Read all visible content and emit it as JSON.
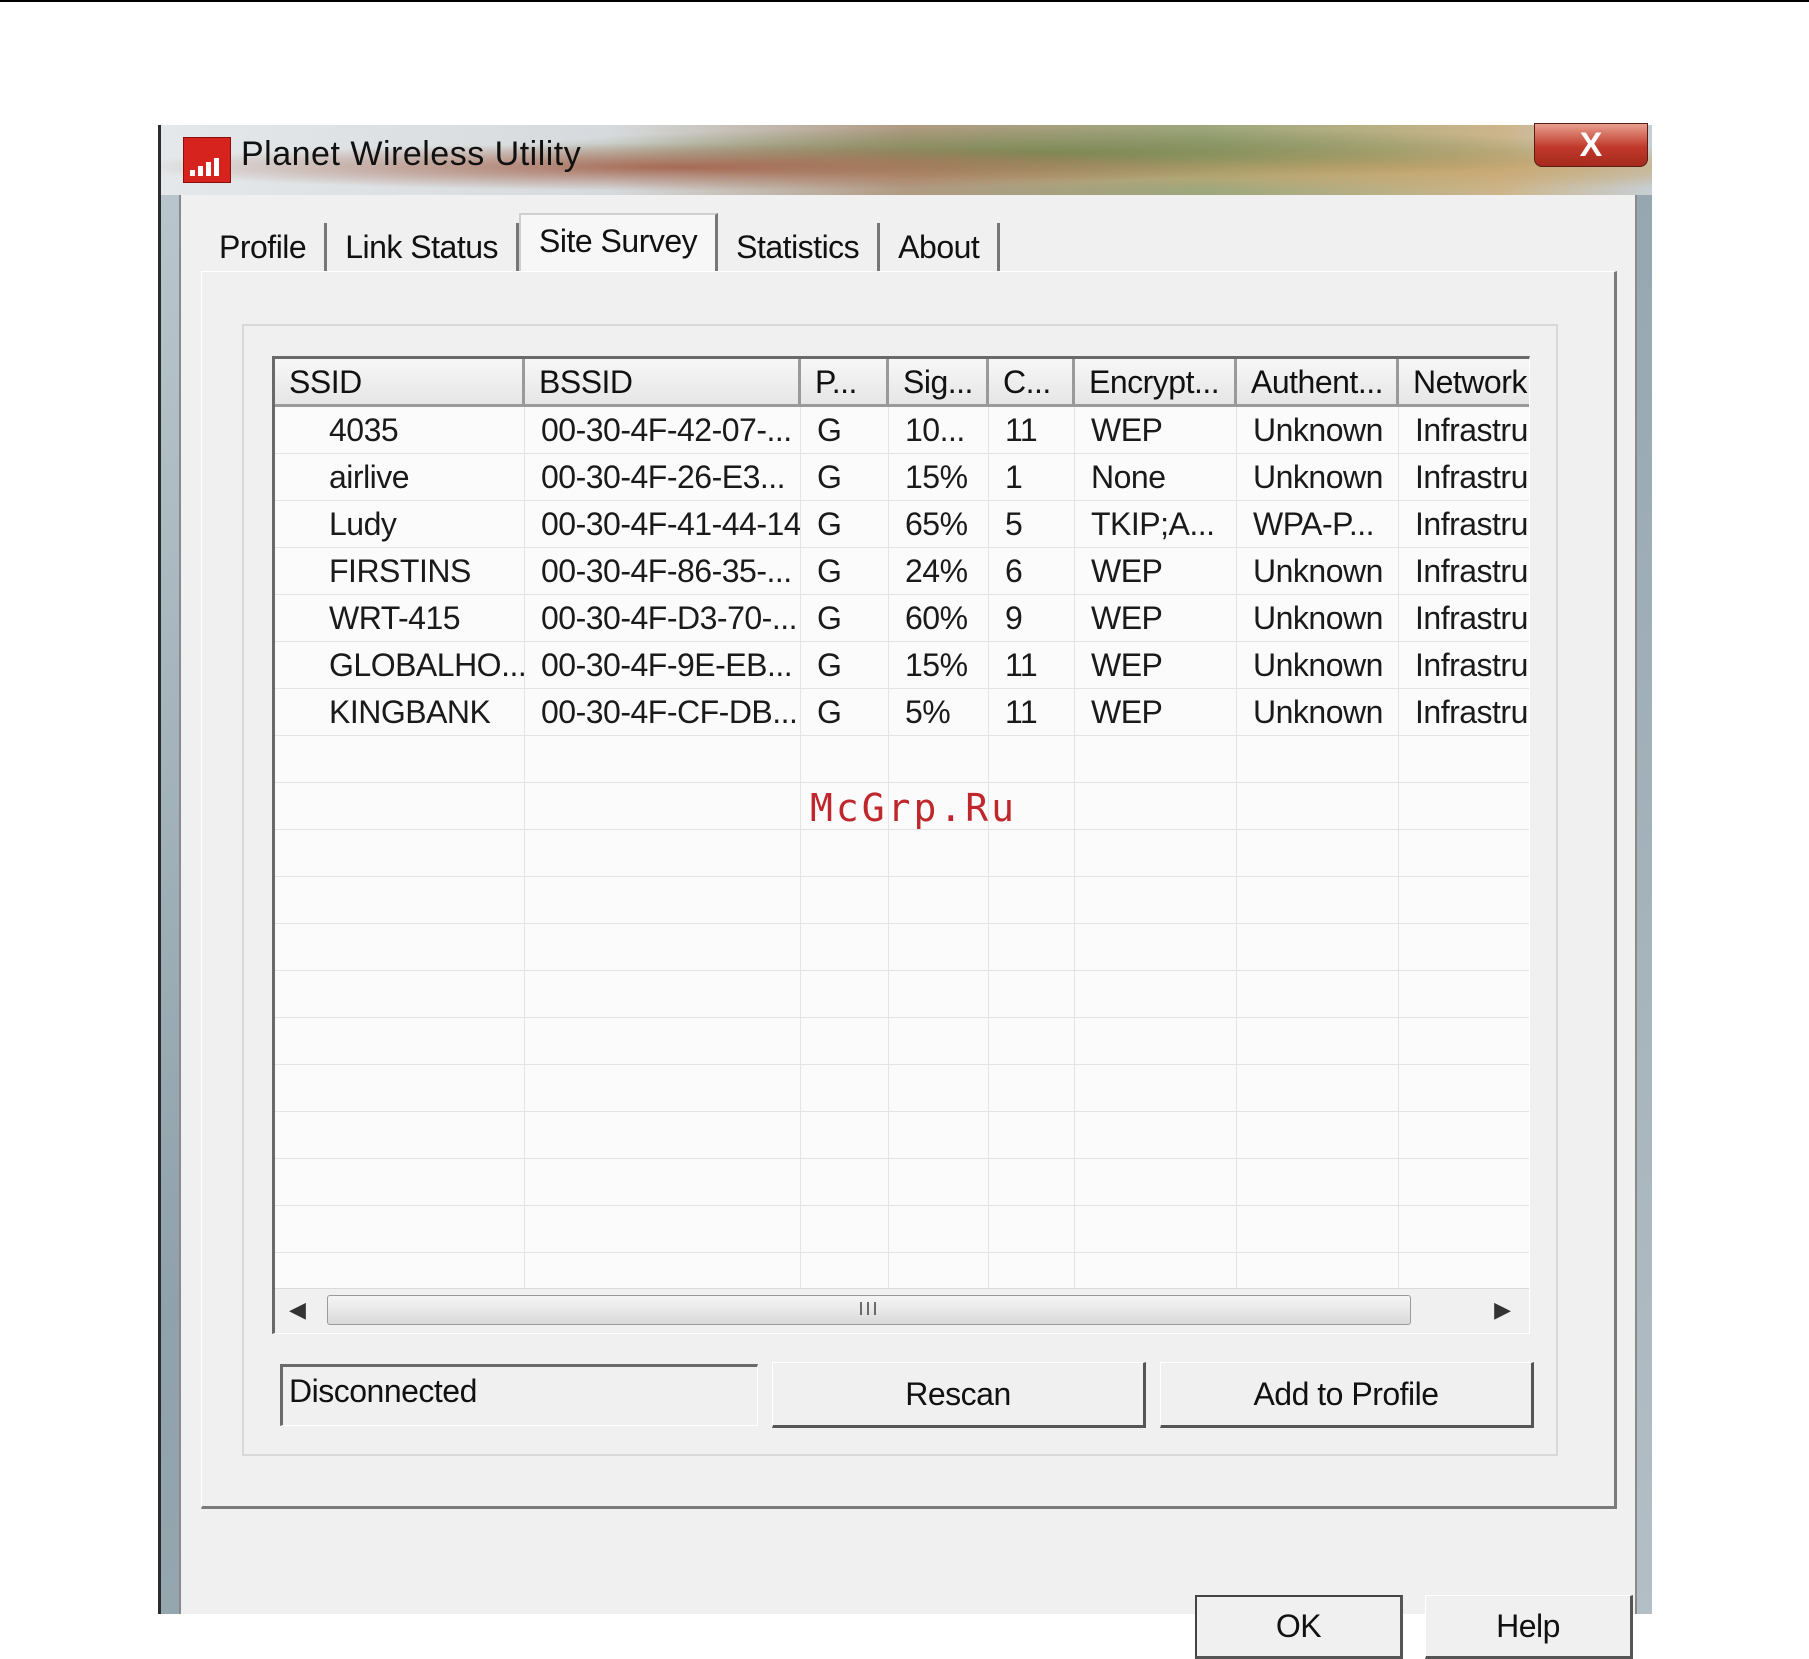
{
  "window": {
    "title": "Planet Wireless Utility",
    "close_glyph": "X"
  },
  "tabs": [
    {
      "label": "Profile",
      "active": false
    },
    {
      "label": "Link Status",
      "active": false
    },
    {
      "label": "Site Survey",
      "active": true
    },
    {
      "label": "Statistics",
      "active": false
    },
    {
      "label": "About",
      "active": false
    }
  ],
  "site_survey": {
    "columns": [
      "SSID",
      "BSSID",
      "P...",
      "Sig...",
      "C...",
      "Encrypt...",
      "Authent...",
      "Network"
    ],
    "rows": [
      [
        "4035",
        "00-30-4F-42-07-...",
        "G",
        "10...",
        "11",
        "WEP",
        "Unknown",
        "Infrastruc"
      ],
      [
        "airlive",
        "00-30-4F-26-E3...",
        "G",
        "15%",
        "1",
        "None",
        "Unknown",
        "Infrastruc"
      ],
      [
        "Ludy",
        "00-30-4F-41-44-14",
        "G",
        "65%",
        "5",
        "TKIP;A...",
        "WPA-P...",
        "Infrastruc"
      ],
      [
        "FIRSTINS",
        "00-30-4F-86-35-...",
        "G",
        "24%",
        "6",
        "WEP",
        "Unknown",
        "Infrastruc"
      ],
      [
        "WRT-415",
        "00-30-4F-D3-70-...",
        "G",
        "60%",
        "9",
        "WEP",
        "Unknown",
        "Infrastruc"
      ],
      [
        "GLOBALHO...",
        "00-30-4F-9E-EB...",
        "G",
        "15%",
        "11",
        "WEP",
        "Unknown",
        "Infrastruc"
      ],
      [
        "KINGBANK",
        "00-30-4F-CF-DB...",
        "G",
        "5%",
        "11",
        "WEP",
        "Unknown",
        "Infrastruc"
      ]
    ],
    "scrollbar_grip": "III",
    "status_text": "Disconnected",
    "rescan_label": "Rescan",
    "add_to_profile_label": "Add to Profile"
  },
  "footer": {
    "ok_label": "OK",
    "help_label": "Help"
  },
  "watermark": "McGrp.Ru",
  "colors": {
    "accent_red": "#d6231d",
    "watermark": "#c0272d"
  }
}
